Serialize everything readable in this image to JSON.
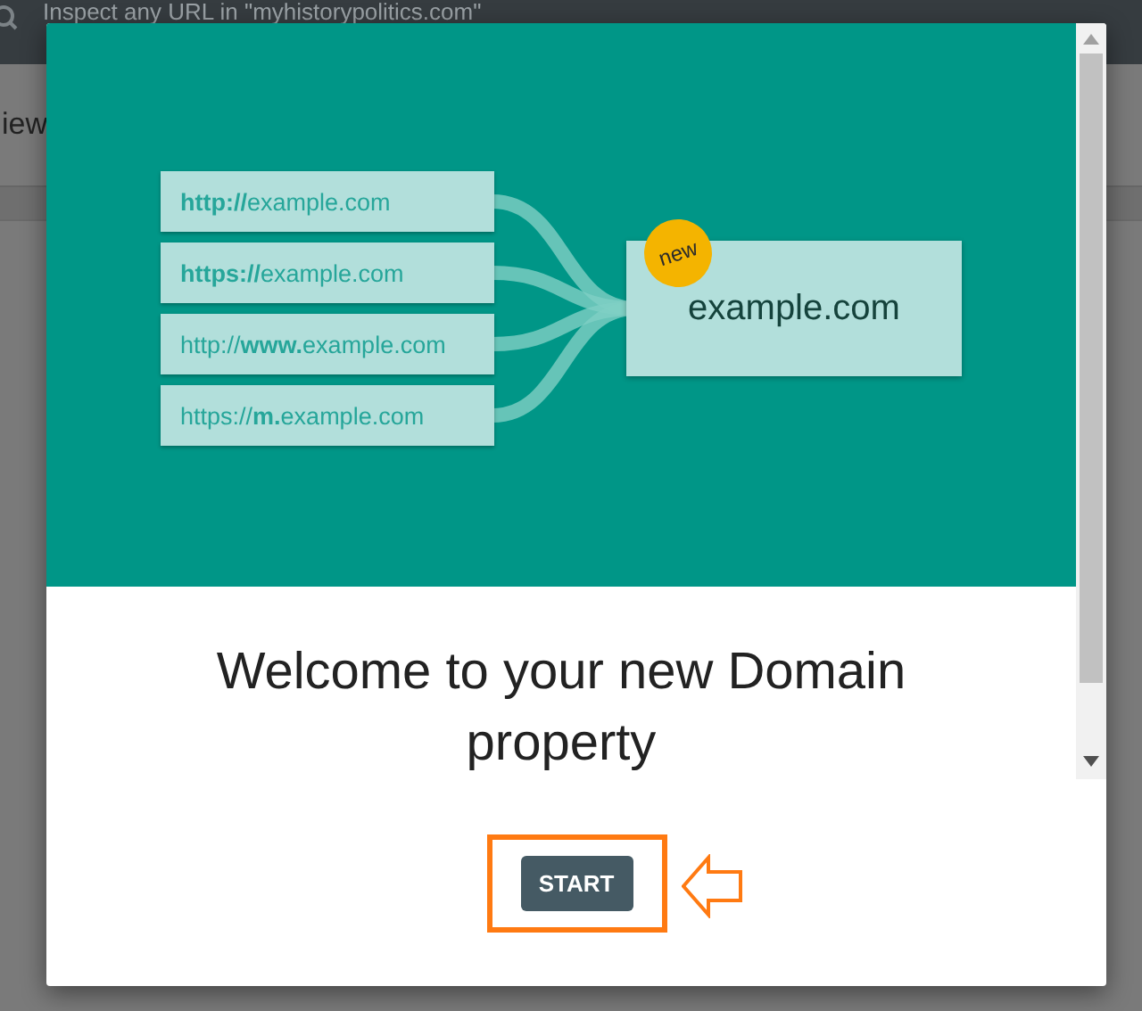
{
  "background": {
    "search_placeholder": "Inspect any URL in \"myhistorypolitics.com\"",
    "heading": "iew"
  },
  "dialog": {
    "urls": [
      "**http://**example.com",
      "**https://**example.com",
      "http://**www.**example.com",
      "https://**m.**example.com"
    ],
    "badge": "new",
    "domain": "example.com",
    "title": "Welcome to your new Domain property",
    "button": "START",
    "highlighted": true
  }
}
